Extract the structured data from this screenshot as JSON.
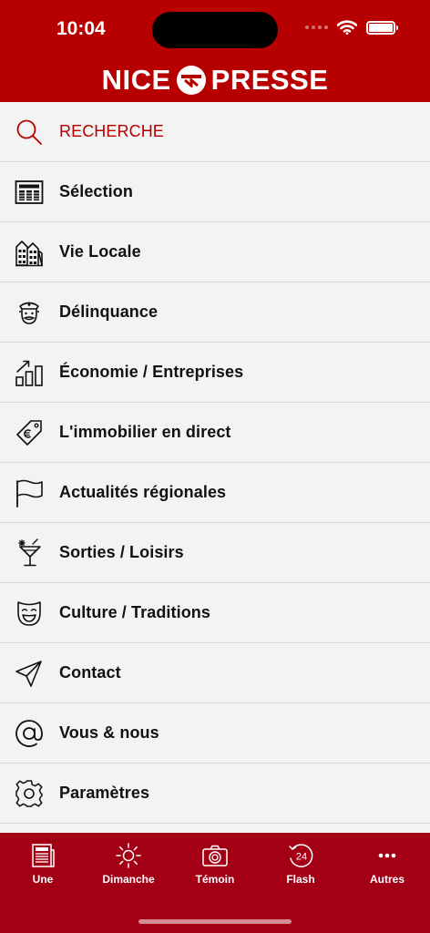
{
  "status_bar": {
    "time": "10:04"
  },
  "header": {
    "logo_left": "NICE",
    "logo_right": "PRESSE"
  },
  "menu": [
    {
      "label": "RECHERCHE",
      "icon": "search-icon"
    },
    {
      "label": "Sélection",
      "icon": "newspaper-icon"
    },
    {
      "label": "Vie Locale",
      "icon": "buildings-icon"
    },
    {
      "label": "Délinquance",
      "icon": "police-officer-icon"
    },
    {
      "label": "Économie / Entreprises",
      "icon": "growth-chart-icon"
    },
    {
      "label": "L'immobilier en direct",
      "icon": "price-tag-icon"
    },
    {
      "label": "Actualités régionales",
      "icon": "flag-icon"
    },
    {
      "label": "Sorties / Loisirs",
      "icon": "cocktail-icon"
    },
    {
      "label": "Culture / Traditions",
      "icon": "theater-mask-icon"
    },
    {
      "label": "Contact",
      "icon": "send-icon"
    },
    {
      "label": "Vous & nous",
      "icon": "at-sign-icon"
    },
    {
      "label": "Paramètres",
      "icon": "gear-icon"
    }
  ],
  "tabbar": [
    {
      "label": "Une",
      "icon": "newspaper-icon"
    },
    {
      "label": "Dimanche",
      "icon": "sun-icon"
    },
    {
      "label": "Témoin",
      "icon": "camera-icon"
    },
    {
      "label": "Flash",
      "icon": "clock-24-icon",
      "icon_text": "24"
    },
    {
      "label": "Autres",
      "icon": "more-icon"
    }
  ],
  "colors": {
    "brand_red": "#b70000",
    "tabbar_red": "#a30016",
    "background": "#f2f3f2"
  }
}
